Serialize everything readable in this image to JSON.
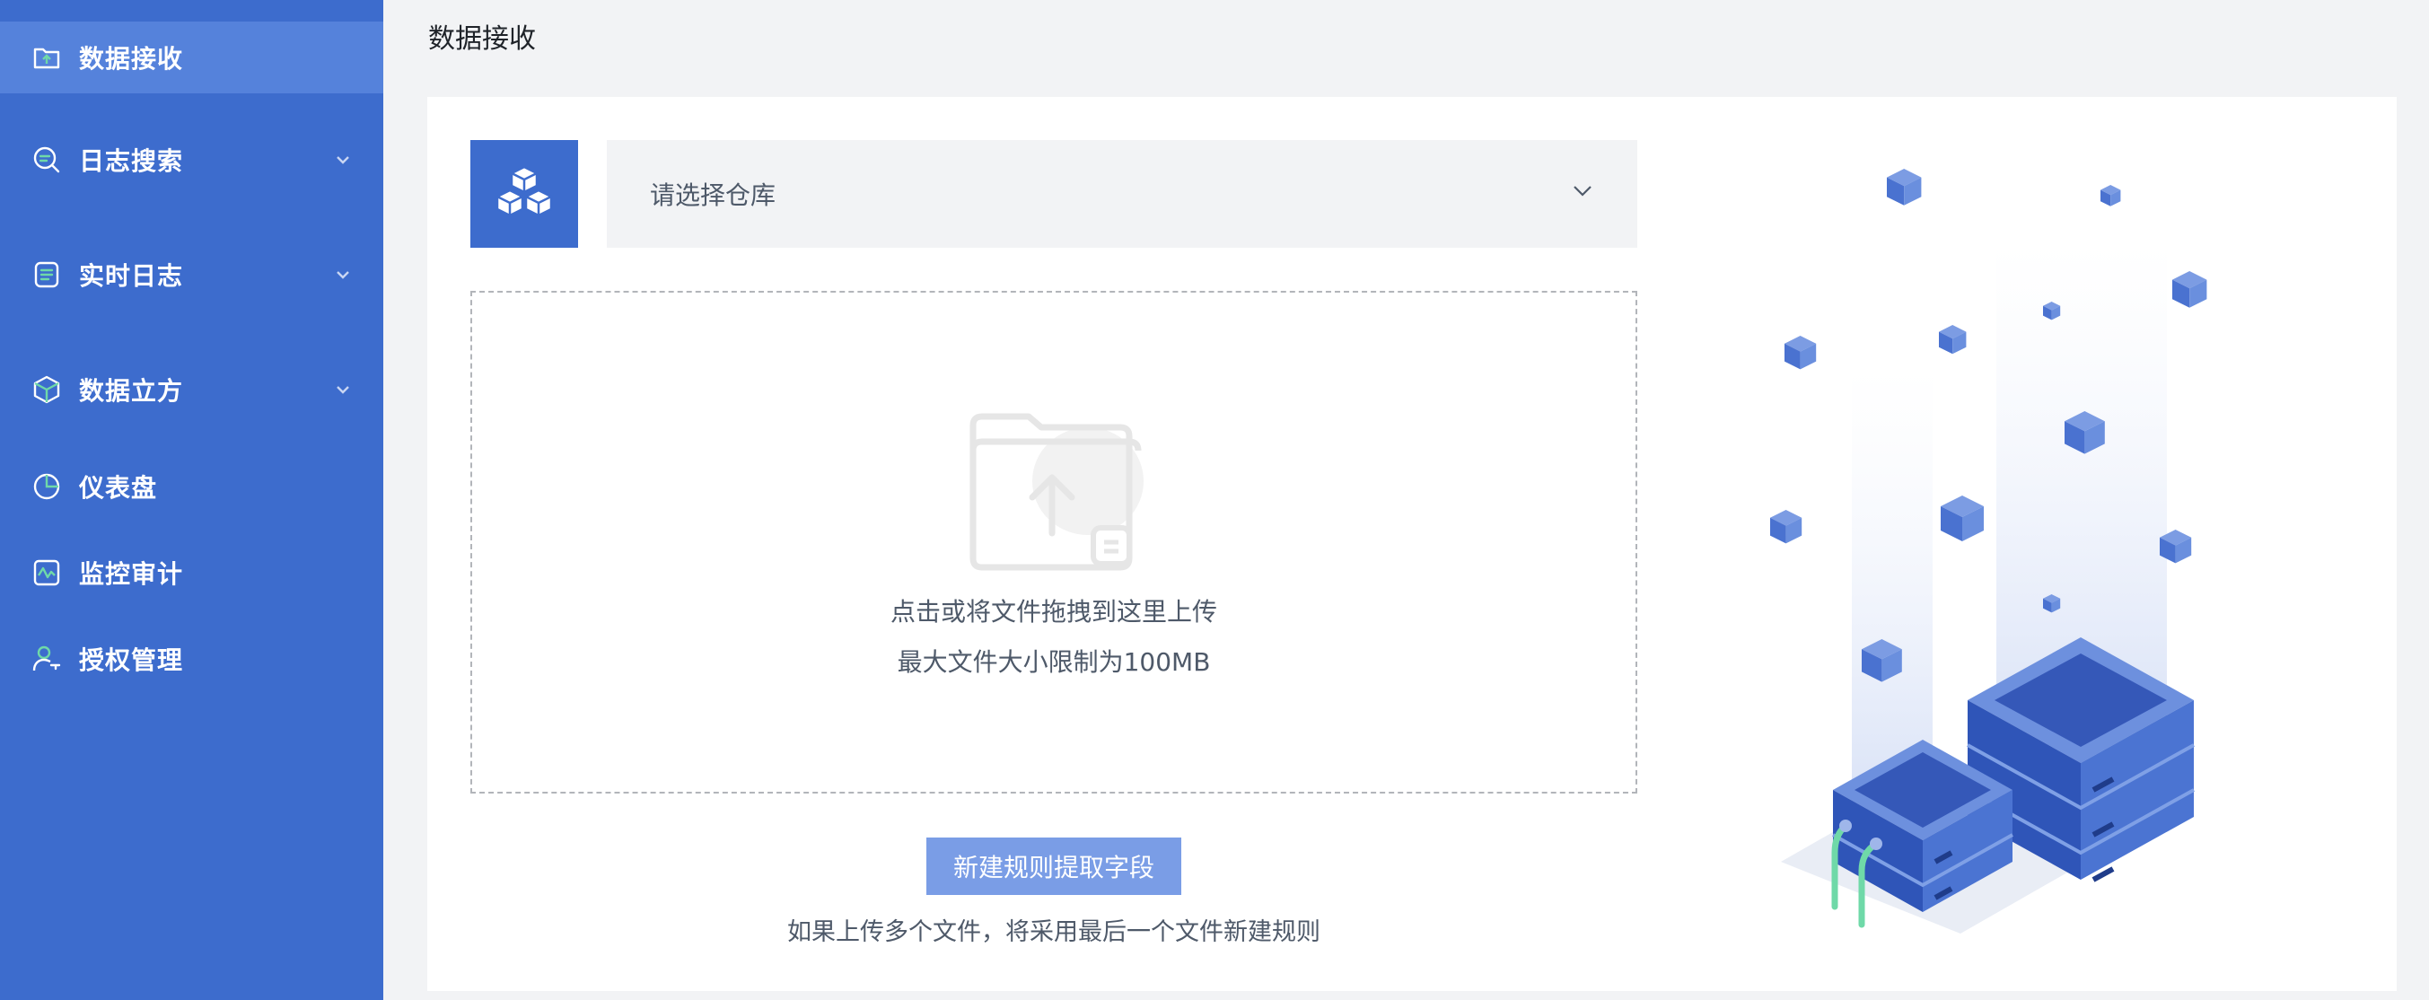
{
  "sidebar": {
    "items": [
      {
        "label": "数据接收",
        "icon": "upload-folder-icon",
        "active": true,
        "expandable": false
      },
      {
        "label": "日志搜索",
        "icon": "search-log-icon",
        "active": false,
        "expandable": true
      },
      {
        "label": "实时日志",
        "icon": "realtime-list-icon",
        "active": false,
        "expandable": true
      },
      {
        "label": "数据立方",
        "icon": "cube-icon",
        "active": false,
        "expandable": true
      },
      {
        "label": "仪表盘",
        "icon": "pie-chart-icon",
        "active": false,
        "expandable": false
      },
      {
        "label": "监控审计",
        "icon": "monitor-wave-icon",
        "active": false,
        "expandable": false
      },
      {
        "label": "授权管理",
        "icon": "user-key-icon",
        "active": false,
        "expandable": false
      }
    ]
  },
  "page": {
    "title": "数据接收"
  },
  "warehouse_select": {
    "placeholder": "请选择仓库"
  },
  "upload": {
    "hint": "点击或将文件拖拽到这里上传",
    "limit": "最大文件大小限制为100MB"
  },
  "actions": {
    "new_rule_label": "新建规则提取字段",
    "note": "如果上传多个文件，将采用最后一个文件新建规则"
  },
  "colors": {
    "sidebar_bg": "#3d6ccd",
    "sidebar_active": "#5582db",
    "accent": "#3d6ccd",
    "button_bg": "#7a9de6",
    "icon_green": "#6fd9a8"
  }
}
